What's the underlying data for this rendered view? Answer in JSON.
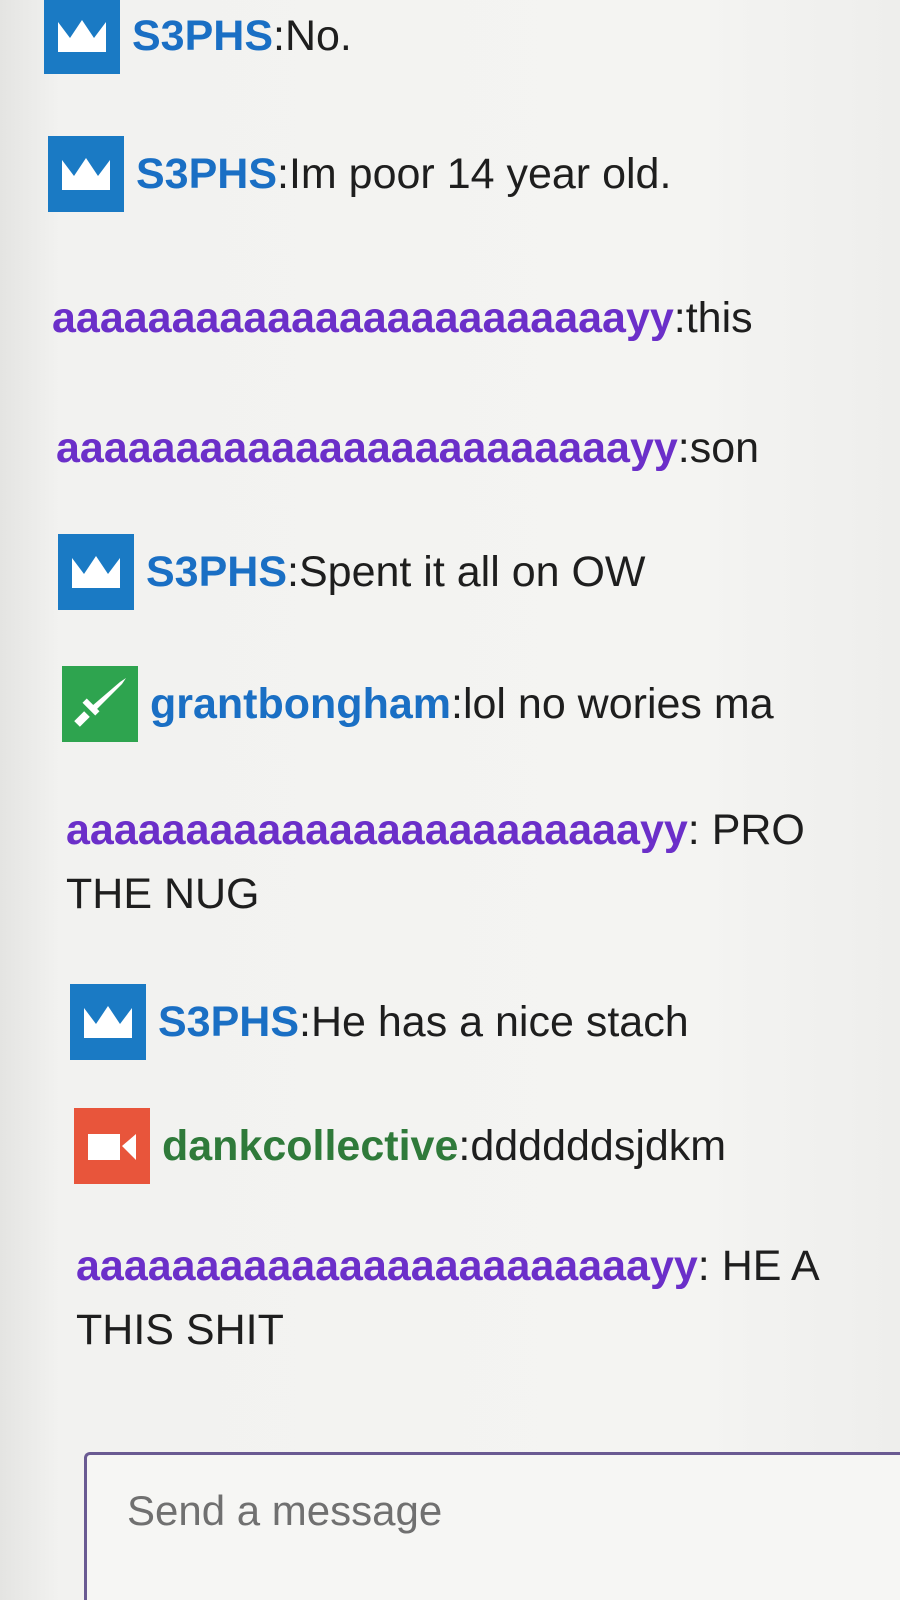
{
  "colors": {
    "mod_blue": "#1a7ac4",
    "broadcaster_red": "#e8553b",
    "turbo_green": "#2ea44f",
    "purple_user": "#6b2fc9",
    "green_user": "#2f7a3a",
    "text": "#1e1e1e"
  },
  "messages": [
    {
      "badge": "crown-icon",
      "user": "S3PHS",
      "sep": ": ",
      "text": "No.",
      "user_color": "#1a6fc4"
    },
    {
      "badge": "crown-icon",
      "user": "S3PHS",
      "sep": ": ",
      "text": "Im poor 14 year old.",
      "user_color": "#1a6fc4"
    },
    {
      "badge": "",
      "user": "aaaaaaaaaaaaaaaaaaaaaaaayy",
      "sep": ": ",
      "text": "this",
      "user_color": "#6b2fc9"
    },
    {
      "badge": "",
      "user": "aaaaaaaaaaaaaaaaaaaaaaaayy",
      "sep": ": ",
      "text": "son",
      "user_color": "#6b2fc9"
    },
    {
      "badge": "crown-icon",
      "user": "S3PHS",
      "sep": ": ",
      "text": "Spent it all on OW",
      "user_color": "#1a6fc4"
    },
    {
      "badge": "sword-icon",
      "user": "grantbongham",
      "sep": ": ",
      "text": "lol no wories ma",
      "user_color": "#1a6fc4"
    },
    {
      "badge": "",
      "user": "aaaaaaaaaaaaaaaaaaaaaaaayy",
      "sep": ": ",
      "text": "PRO",
      "cont": "THE NUG",
      "user_color": "#6b2fc9"
    },
    {
      "badge": "crown-icon",
      "user": "S3PHS",
      "sep": ": ",
      "text": "He has a nice stach",
      "user_color": "#1a6fc4"
    },
    {
      "badge": "camera-icon",
      "user": "dankcollective",
      "sep": ": ",
      "text": "ddddddsjdkm",
      "user_color": "#2f7a3a"
    },
    {
      "badge": "",
      "user": "aaaaaaaaaaaaaaaaaaaaaaaayy",
      "sep": ": ",
      "text": "HE A",
      "cont": "THIS SHIT",
      "user_color": "#6b2fc9"
    }
  ],
  "composer": {
    "placeholder": "Send a message"
  }
}
